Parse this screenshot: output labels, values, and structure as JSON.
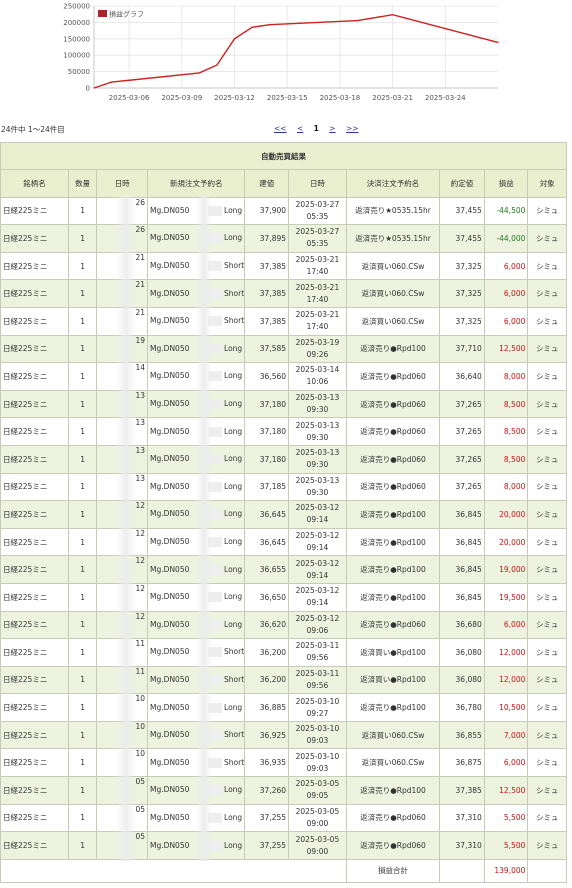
{
  "chart_data": {
    "type": "line",
    "legend": "損益グラフ",
    "legend_position": "top-left",
    "grid": true,
    "y_ticks": [
      "250000",
      "200000",
      "150000",
      "100000",
      "50000",
      "0"
    ],
    "ylim": [
      0,
      250000
    ],
    "x_ticks": [
      "2025-03-06",
      "2025-03-09",
      "2025-03-12",
      "2025-03-15",
      "2025-03-18",
      "2025-03-21",
      "2025-03-24"
    ],
    "xlim": [
      "2025-03-04",
      "2025-03-27"
    ],
    "series": [
      {
        "name": "損益グラフ",
        "color": "#cc2222",
        "points": [
          {
            "x": "2025-03-04",
            "y": 0
          },
          {
            "x": "2025-03-05",
            "y": 18000
          },
          {
            "x": "2025-03-10",
            "y": 46000
          },
          {
            "x": "2025-03-11",
            "y": 70000
          },
          {
            "x": "2025-03-12",
            "y": 150000
          },
          {
            "x": "2025-03-13",
            "y": 185000
          },
          {
            "x": "2025-03-14",
            "y": 193000
          },
          {
            "x": "2025-03-19",
            "y": 205500
          },
          {
            "x": "2025-03-21",
            "y": 223500
          },
          {
            "x": "2025-03-27",
            "y": 139000
          }
        ]
      }
    ]
  },
  "summary": {
    "count_text": "24件中 1～24件目",
    "pager": [
      "<<",
      "<",
      "1",
      ">",
      ">>"
    ]
  },
  "table": {
    "title": "自動売買結果",
    "headers": [
      "銘柄名",
      "数量",
      "日時",
      "新規注文予約名",
      "建値",
      "日時",
      "決済注文予約名",
      "約定値",
      "損益",
      "対象"
    ],
    "rows": [
      {
        "name": "日経225ミニ",
        "qty": "1",
        "date": "26",
        "order": "Mg.DN050",
        "side": "Long",
        "entry": "37,900",
        "dt1": "2025-03-27",
        "dt2": "05:35",
        "close_order": "返済売り★0535.15hr",
        "exit": "37,455",
        "pl": "-44,500",
        "pl_sign": "neg",
        "target": "シミュ"
      },
      {
        "name": "日経225ミニ",
        "qty": "1",
        "date": "26",
        "order": "Mg.DN050",
        "side": "Long",
        "entry": "37,895",
        "dt1": "2025-03-27",
        "dt2": "05:35",
        "close_order": "返済売り★0535.15hr",
        "exit": "37,455",
        "pl": "-44,000",
        "pl_sign": "neg",
        "target": "シミュ"
      },
      {
        "name": "日経225ミニ",
        "qty": "1",
        "date": "21",
        "order": "Mg.DN050",
        "side": "Short",
        "entry": "37,385",
        "dt1": "2025-03-21",
        "dt2": "17:40",
        "close_order": "返済買い060.CSw",
        "exit": "37,325",
        "pl": "6,000",
        "pl_sign": "pos",
        "target": "シミュ"
      },
      {
        "name": "日経225ミニ",
        "qty": "1",
        "date": "21",
        "order": "Mg.DN050",
        "side": "Short",
        "entry": "37,385",
        "dt1": "2025-03-21",
        "dt2": "17:40",
        "close_order": "返済買い060.CSw",
        "exit": "37,325",
        "pl": "6,000",
        "pl_sign": "pos",
        "target": "シミュ"
      },
      {
        "name": "日経225ミニ",
        "qty": "1",
        "date": "21",
        "order": "Mg.DN050",
        "side": "Short",
        "entry": "37,385",
        "dt1": "2025-03-21",
        "dt2": "17:40",
        "close_order": "返済買い060.CSw",
        "exit": "37,325",
        "pl": "6,000",
        "pl_sign": "pos",
        "target": "シミュ"
      },
      {
        "name": "日経225ミニ",
        "qty": "1",
        "date": "19",
        "order": "Mg.DN050",
        "side": "Long",
        "entry": "37,585",
        "dt1": "2025-03-19",
        "dt2": "09:26",
        "close_order": "返済売り●Rpd100",
        "exit": "37,710",
        "pl": "12,500",
        "pl_sign": "pos",
        "target": "シミュ"
      },
      {
        "name": "日経225ミニ",
        "qty": "1",
        "date": "14",
        "order": "Mg.DN050",
        "side": "Long",
        "entry": "36,560",
        "dt1": "2025-03-14",
        "dt2": "10:06",
        "close_order": "返済売り●Rpd060",
        "exit": "36,640",
        "pl": "8,000",
        "pl_sign": "pos",
        "target": "シミュ"
      },
      {
        "name": "日経225ミニ",
        "qty": "1",
        "date": "13",
        "order": "Mg.DN050",
        "side": "Long",
        "entry": "37,180",
        "dt1": "2025-03-13",
        "dt2": "09:30",
        "close_order": "返済売り●Rpd060",
        "exit": "37,265",
        "pl": "8,500",
        "pl_sign": "pos",
        "target": "シミュ"
      },
      {
        "name": "日経225ミニ",
        "qty": "1",
        "date": "13",
        "order": "Mg.DN050",
        "side": "Long",
        "entry": "37,180",
        "dt1": "2025-03-13",
        "dt2": "09:30",
        "close_order": "返済売り●Rpd060",
        "exit": "37,265",
        "pl": "8,500",
        "pl_sign": "pos",
        "target": "シミュ"
      },
      {
        "name": "日経225ミニ",
        "qty": "1",
        "date": "13",
        "order": "Mg.DN050",
        "side": "Long",
        "entry": "37,180",
        "dt1": "2025-03-13",
        "dt2": "09:30",
        "close_order": "返済売り●Rpd060",
        "exit": "37,265",
        "pl": "8,500",
        "pl_sign": "pos",
        "target": "シミュ"
      },
      {
        "name": "日経225ミニ",
        "qty": "1",
        "date": "13",
        "order": "Mg.DN050",
        "side": "Long",
        "entry": "37,185",
        "dt1": "2025-03-13",
        "dt2": "09:30",
        "close_order": "返済売り●Rpd060",
        "exit": "37,265",
        "pl": "8,000",
        "pl_sign": "pos",
        "target": "シミュ"
      },
      {
        "name": "日経225ミニ",
        "qty": "1",
        "date": "12",
        "order": "Mg.DN050",
        "side": "Long",
        "entry": "36,645",
        "dt1": "2025-03-12",
        "dt2": "09:14",
        "close_order": "返済売り●Rpd100",
        "exit": "36,845",
        "pl": "20,000",
        "pl_sign": "pos",
        "target": "シミュ"
      },
      {
        "name": "日経225ミニ",
        "qty": "1",
        "date": "12",
        "order": "Mg.DN050",
        "side": "Long",
        "entry": "36,645",
        "dt1": "2025-03-12",
        "dt2": "09:14",
        "close_order": "返済売り●Rpd100",
        "exit": "36,845",
        "pl": "20,000",
        "pl_sign": "pos",
        "target": "シミュ"
      },
      {
        "name": "日経225ミニ",
        "qty": "1",
        "date": "12",
        "order": "Mg.DN050",
        "side": "Long",
        "entry": "36,655",
        "dt1": "2025-03-12",
        "dt2": "09:14",
        "close_order": "返済売り●Rpd100",
        "exit": "36,845",
        "pl": "19,000",
        "pl_sign": "pos",
        "target": "シミュ"
      },
      {
        "name": "日経225ミニ",
        "qty": "1",
        "date": "12",
        "order": "Mg.DN050",
        "side": "Long",
        "entry": "36,650",
        "dt1": "2025-03-12",
        "dt2": "09:14",
        "close_order": "返済売り●Rpd100",
        "exit": "36,845",
        "pl": "19,500",
        "pl_sign": "pos",
        "target": "シミュ"
      },
      {
        "name": "日経225ミニ",
        "qty": "1",
        "date": "12",
        "order": "Mg.DN050",
        "side": "Long",
        "entry": "36,620",
        "dt1": "2025-03-12",
        "dt2": "09:06",
        "close_order": "返済売り●Rpd060",
        "exit": "36,680",
        "pl": "6,000",
        "pl_sign": "pos",
        "target": "シミュ"
      },
      {
        "name": "日経225ミニ",
        "qty": "1",
        "date": "11",
        "order": "Mg.DN050",
        "side": "Short",
        "entry": "36,200",
        "dt1": "2025-03-11",
        "dt2": "09:56",
        "close_order": "返済買い●Rpd100",
        "exit": "36,080",
        "pl": "12,000",
        "pl_sign": "pos",
        "target": "シミュ"
      },
      {
        "name": "日経225ミニ",
        "qty": "1",
        "date": "11",
        "order": "Mg.DN050",
        "side": "Short",
        "entry": "36,200",
        "dt1": "2025-03-11",
        "dt2": "09:56",
        "close_order": "返済買い●Rpd100",
        "exit": "36,080",
        "pl": "12,000",
        "pl_sign": "pos",
        "target": "シミュ"
      },
      {
        "name": "日経225ミニ",
        "qty": "1",
        "date": "10",
        "order": "Mg.DN050",
        "side": "Long",
        "entry": "36,885",
        "dt1": "2025-03-10",
        "dt2": "09:27",
        "close_order": "返済売り●Rpd100",
        "exit": "36,780",
        "pl": "10,500",
        "pl_sign": "pos",
        "target": "シミュ"
      },
      {
        "name": "日経225ミニ",
        "qty": "1",
        "date": "10",
        "order": "Mg.DN050",
        "side": "Short",
        "entry": "36,925",
        "dt1": "2025-03-10",
        "dt2": "09:03",
        "close_order": "返済買い060.CSw",
        "exit": "36,855",
        "pl": "7,000",
        "pl_sign": "pos",
        "target": "シミュ"
      },
      {
        "name": "日経225ミニ",
        "qty": "1",
        "date": "10",
        "order": "Mg.DN050",
        "side": "Short",
        "entry": "36,935",
        "dt1": "2025-03-10",
        "dt2": "09:03",
        "close_order": "返済買い060.CSw",
        "exit": "36,875",
        "pl": "6,000",
        "pl_sign": "pos",
        "target": "シミュ"
      },
      {
        "name": "日経225ミニ",
        "qty": "1",
        "date": "05",
        "order": "Mg.DN050",
        "side": "Long",
        "entry": "37,260",
        "dt1": "2025-03-05",
        "dt2": "09:05",
        "close_order": "返済売り●Rpd100",
        "exit": "37,385",
        "pl": "12,500",
        "pl_sign": "pos",
        "target": "シミュ"
      },
      {
        "name": "日経225ミニ",
        "qty": "1",
        "date": "05",
        "order": "Mg.DN050",
        "side": "Long",
        "entry": "37,255",
        "dt1": "2025-03-05",
        "dt2": "09:00",
        "close_order": "返済売り●Rpd060",
        "exit": "37,310",
        "pl": "5,500",
        "pl_sign": "pos",
        "target": "シミュ"
      },
      {
        "name": "日経225ミニ",
        "qty": "1",
        "date": "05",
        "order": "Mg.DN050",
        "side": "Long",
        "entry": "37,255",
        "dt1": "2025-03-05",
        "dt2": "09:00",
        "close_order": "返済売り●Rpd060",
        "exit": "37,310",
        "pl": "5,500",
        "pl_sign": "pos",
        "target": "シミュ"
      }
    ],
    "total_label": "損益合計",
    "total_value": "139,000"
  },
  "colors": {
    "header_bg": "#e9efcf",
    "row_alt_bg": "#eef3e0",
    "loss": "#1f7a1f",
    "profit": "#cc1111",
    "line": "#cc2222",
    "link": "#2a3a9c"
  }
}
